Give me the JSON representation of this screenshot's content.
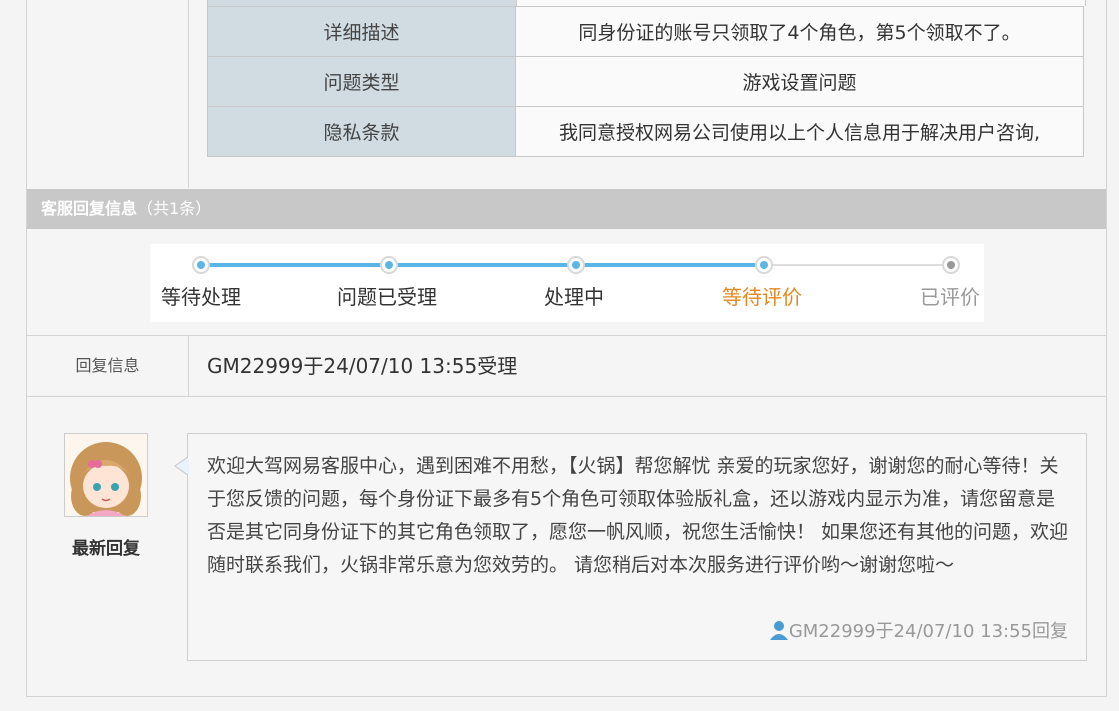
{
  "info_table": {
    "rows": [
      {
        "label": "详细描述",
        "value": "同身份证的账号只领取了4个角色，第5个领取不了。"
      },
      {
        "label": "问题类型",
        "value": "游戏设置问题"
      },
      {
        "label": "隐私条款",
        "value": "我同意授权网易公司使用以上个人信息用于解决用户咨询,"
      }
    ]
  },
  "reply_section": {
    "title": "客服回复信息",
    "count": "（共1条）"
  },
  "progress": {
    "steps": [
      {
        "label": "等待处理",
        "state": "done"
      },
      {
        "label": "问题已受理",
        "state": "done"
      },
      {
        "label": "处理中",
        "state": "done"
      },
      {
        "label": "等待评价",
        "state": "current"
      },
      {
        "label": "已评价",
        "state": "todo"
      }
    ],
    "colors": {
      "done": "#5bb6e8",
      "current": "#e4871c",
      "todo": "#bbbbbb"
    }
  },
  "reply_info": {
    "label": "回复信息",
    "value": "GM22999于24/07/10 13:55受理"
  },
  "reply": {
    "avatar_caption": "最新回复",
    "message": "欢迎大驾网易客服中心，遇到困难不用愁，【火锅】帮您解忧  亲爱的玩家您好，谢谢您的耐心等待！关于您反馈的问题，每个身份证下最多有5个角色可领取体验版礼盒，还以游戏内显示为准，请您留意是否是其它同身份证下的其它角色领取了，愿您一帆风顺，祝您生活愉快！  如果您还有其他的问题，欢迎随时联系我们，火锅非常乐意为您效劳的。 请您稍后对本次服务进行评价哟～谢谢您啦～",
    "footer": "GM22999于24/07/10 13:55回复",
    "icon": "user-icon"
  }
}
